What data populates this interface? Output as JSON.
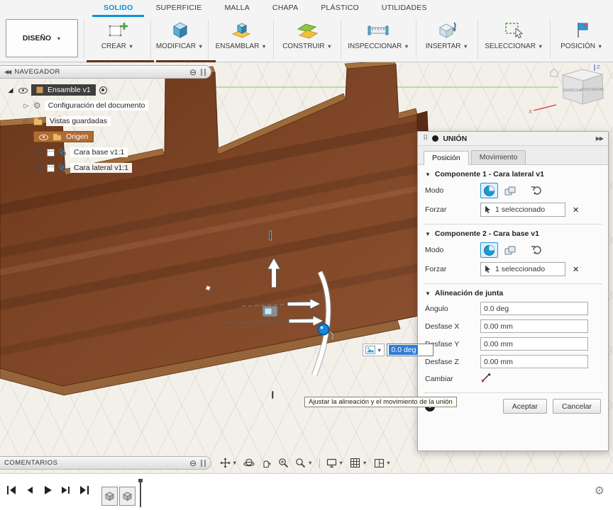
{
  "ribbon": {
    "design_button": "DISEÑO",
    "tabs": [
      {
        "label": "SOLIDO"
      },
      {
        "label": "SUPERFICIE"
      },
      {
        "label": "MALLA"
      },
      {
        "label": "CHAPA"
      },
      {
        "label": "PLÁSTICO"
      },
      {
        "label": "UTILIDADES"
      }
    ],
    "active_tab": "SOLIDO",
    "groups": [
      {
        "label": "CREAR"
      },
      {
        "label": "MODIFICAR"
      },
      {
        "label": "ENSAMBLAR"
      },
      {
        "label": "CONSTRUIR"
      },
      {
        "label": "INSPECCIONAR"
      },
      {
        "label": "INSERTAR"
      },
      {
        "label": "SELECCIONAR"
      },
      {
        "label": "POSICIÓN"
      }
    ]
  },
  "navigator": {
    "title": "NAVEGADOR",
    "root_label": "Ensamble v1",
    "rows": [
      {
        "label": "Configuración del documento"
      },
      {
        "label": "Vistas guardadas"
      },
      {
        "label": "Origen"
      },
      {
        "label": "Cara base v1:1"
      },
      {
        "label": "Cara lateral v1:1"
      }
    ]
  },
  "joint_dialog": {
    "title": "UNIÓN",
    "tabs": [
      {
        "label": "Posición"
      },
      {
        "label": "Movimiento"
      }
    ],
    "component1": {
      "title": "Componente 1 - Cara lateral v1",
      "mode_label": "Modo",
      "snap_label": "Forzar",
      "snap_value": "1 seleccionado"
    },
    "component2": {
      "title": "Componente 2 - Cara base v1",
      "mode_label": "Modo",
      "snap_label": "Forzar",
      "snap_value": "1 seleccionado"
    },
    "alignment": {
      "title": "Alineación de junta",
      "fields": [
        {
          "label": "Ángulo",
          "value": "0.0 deg"
        },
        {
          "label": "Desfase X",
          "value": "0.00 mm"
        },
        {
          "label": "Desfase Y",
          "value": "0.00 mm"
        },
        {
          "label": "Desfase Z",
          "value": "0.00 mm"
        }
      ],
      "flip_label": "Cambiar"
    },
    "buttons": {
      "accept": "Aceptar",
      "cancel": "Cancelar"
    }
  },
  "viewport": {
    "angle_value": "0.0 deg",
    "tooltip": "Ajustar la alineación y el movimiento de la unión",
    "comments_title": "COMENTARIOS",
    "viewcube": {
      "right_face": "DERECHA",
      "back_face": "POSTERIOR",
      "axis_x": "X",
      "axis_z": "Z"
    }
  },
  "colors": {
    "accent_blue": "#0696d7",
    "selection_blue": "#2e7cd6",
    "wood_front": "#713c20",
    "wood_top": "#a4713f",
    "origin_highlight": "#b06c33"
  }
}
